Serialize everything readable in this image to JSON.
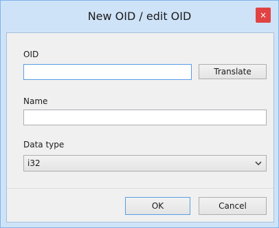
{
  "window": {
    "title": "New OID / edit OID",
    "close_symbol": "×"
  },
  "form": {
    "oid_label": "OID",
    "oid_value": "",
    "translate_label": "Translate",
    "name_label": "Name",
    "name_value": "",
    "datatype_label": "Data type",
    "datatype_selected": "i32"
  },
  "buttons": {
    "ok_label": "OK",
    "cancel_label": "Cancel"
  },
  "icons": {
    "close": "close-icon",
    "dropdown": "chevron-down-icon"
  },
  "colors": {
    "title_bar": "#cfe3f8",
    "close_button": "#e04343",
    "focus_border": "#569de5"
  }
}
